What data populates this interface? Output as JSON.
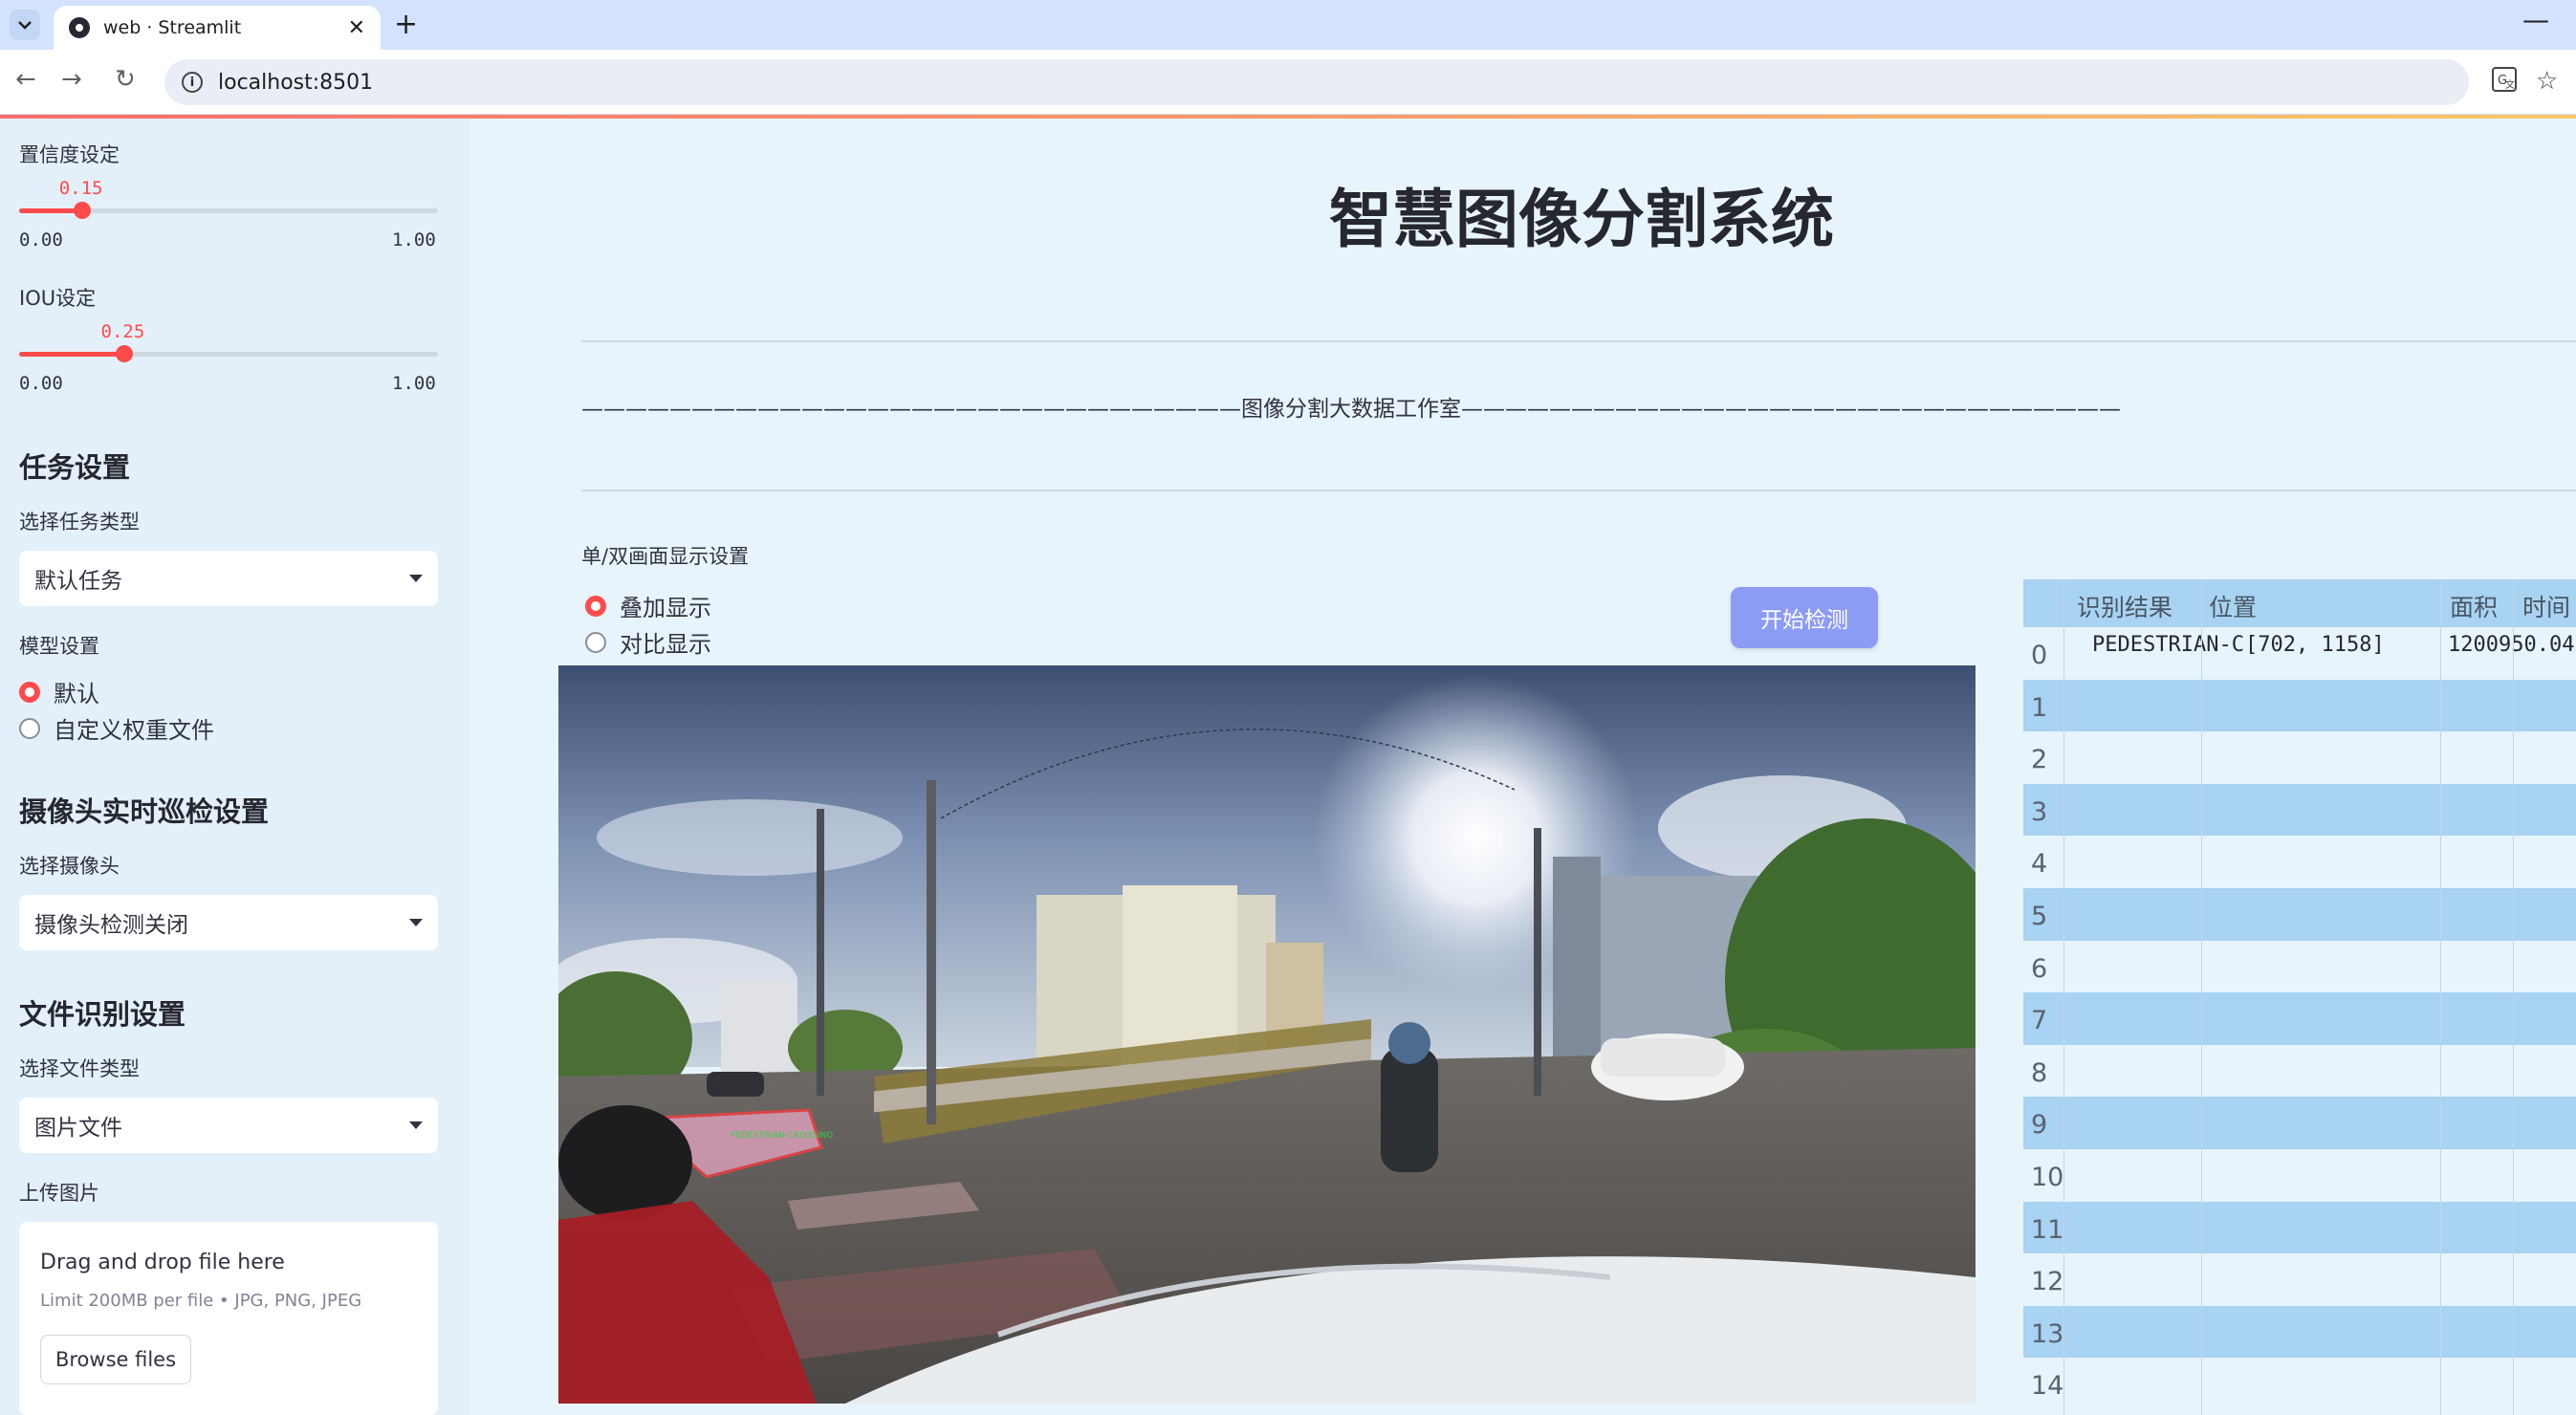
{
  "browser": {
    "tab_title": "web · Streamlit",
    "url": "localhost:8501"
  },
  "sidebar": {
    "confidence": {
      "label": "置信度设定",
      "value": "0.15",
      "min": "0.00",
      "max": "1.00",
      "fraction": 0.15
    },
    "iou": {
      "label": "IOU设定",
      "value": "0.25",
      "min": "0.00",
      "max": "1.00",
      "fraction": 0.25
    },
    "task": {
      "heading": "任务设置",
      "label": "选择任务类型",
      "selected": "默认任务"
    },
    "model": {
      "label": "模型设置",
      "options": [
        "默认",
        "自定义权重文件"
      ],
      "selected_index": 0
    },
    "camera": {
      "heading": "摄像头实时巡检设置",
      "label": "选择摄像头",
      "selected": "摄像头检测关闭"
    },
    "file": {
      "heading": "文件识别设置",
      "label": "选择文件类型",
      "selected": "图片文件"
    },
    "upload": {
      "label": "上传图片",
      "drag_text": "Drag and drop file here",
      "limit_text": "Limit 200MB per file • JPG, PNG, JPEG",
      "browse_label": "Browse files"
    }
  },
  "main": {
    "title": "智慧图像分割系统",
    "banner": "——————————————————————————————图像分割大数据工作室——————————————————————————————",
    "display_label": "单/双画面显示设置",
    "display_options": [
      "叠加显示",
      "对比显示"
    ],
    "display_selected_index": 0,
    "start_button": "开始检测",
    "detection_label": "PEDESTRIAN-CROSSING"
  },
  "table": {
    "columns": [
      "识别结果",
      "位置",
      "面积",
      "时间"
    ],
    "rows": [
      {
        "index": "0",
        "result": "PEDESTRIAN-C",
        "position": "[702, 1158]",
        "area": "1200950.04"
      },
      {
        "index": "1"
      },
      {
        "index": "2"
      },
      {
        "index": "3"
      },
      {
        "index": "4"
      },
      {
        "index": "5"
      },
      {
        "index": "6"
      },
      {
        "index": "7"
      },
      {
        "index": "8"
      },
      {
        "index": "9"
      },
      {
        "index": "10"
      },
      {
        "index": "11"
      },
      {
        "index": "12"
      },
      {
        "index": "13"
      },
      {
        "index": "14"
      }
    ]
  },
  "colors": {
    "accent": "#ff4b4b",
    "button": "#8c9cf5",
    "table_stripe": "#a8d3f2",
    "page_bg": "#e8f4fb"
  }
}
